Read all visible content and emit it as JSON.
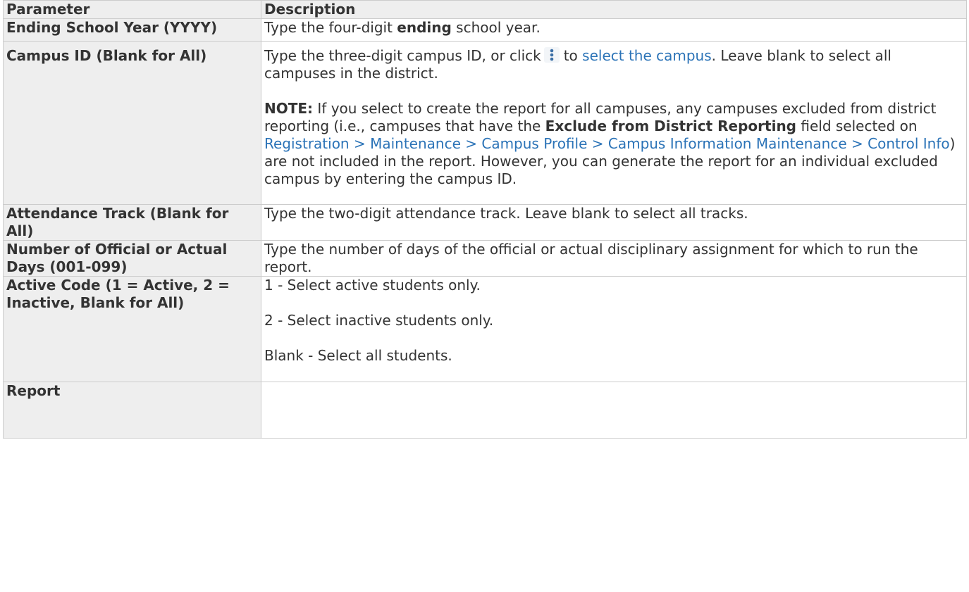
{
  "headers": {
    "parameter": "Parameter",
    "description": "Description"
  },
  "rows": {
    "year": {
      "param": "Ending School Year (YYYY)",
      "desc_pre": "Type the four-digit ",
      "desc_bold": "ending",
      "desc_post": " school year."
    },
    "campus": {
      "param": "Campus ID (Blank for All)",
      "desc1_pre": "Type the three-digit campus ID, or click",
      "desc1_mid": "to ",
      "desc1_link": "select the campus",
      "desc1_post": ". Leave blank to select all campuses in the district.",
      "note_label": "NOTE:",
      "note_1": " If you select to create the report for all campuses, any campuses excluded from district reporting (i.e., campuses that have the ",
      "note_bold": "Exclude from District Reporting",
      "note_2": " field selected on ",
      "note_link": "Registration > Maintenance > Campus Profile > Campus Information Maintenance > Control Info",
      "note_3": ") are not included in the report. However, you can generate the report for an individual excluded campus by entering the campus ID."
    },
    "track": {
      "param": "Attendance Track (Blank for All)",
      "desc": "Type the two-digit attendance track. Leave blank to select all tracks."
    },
    "days": {
      "param": "Number of Official or Actual Days (001-099)",
      "desc": "Type the number of days of the official or actual disciplinary assignment for which to run the report."
    },
    "active": {
      "param": "Active Code (1 = Active, 2 = Inactive, Blank for All)",
      "opt1": "1 - Select active students only.",
      "opt2": "2 - Select inactive students only.",
      "opt3": "Blank - Select all students."
    },
    "report": {
      "param": "Report"
    }
  },
  "colors": {
    "header_bg": "#eeeeee",
    "border": "#cccccc",
    "link": "#2b73b7",
    "text": "#333333"
  },
  "icons": {
    "campus_lookup": "kebab-menu-icon"
  }
}
